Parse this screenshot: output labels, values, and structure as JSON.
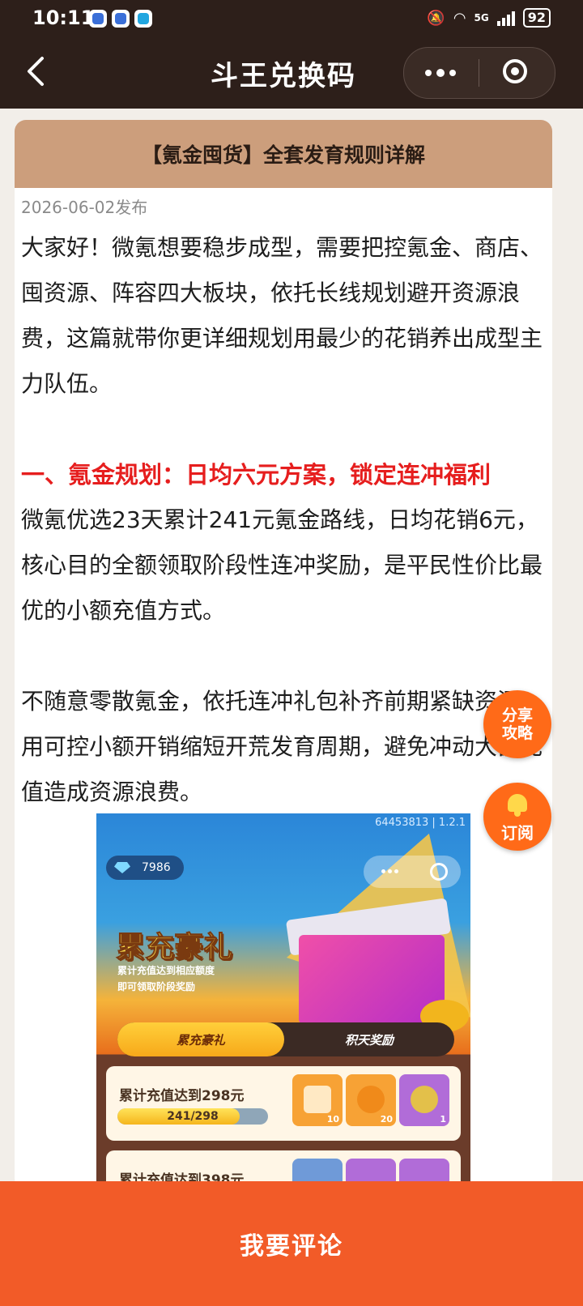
{
  "status": {
    "time": "10:11",
    "network": "5G",
    "battery": "92"
  },
  "header": {
    "title": "斗王兑换码"
  },
  "article": {
    "heading": "【氪金囤货】全套发育规则详解",
    "date": "2026-06-02发布",
    "intro": "大家好！微氪想要稳步成型，需要把控氪金、商店、囤资源、阵容四大板块，依托长线规划避开资源浪费，这篇就带你更详细规划用最少的花销养出成型主力队伍。",
    "section1_title": "一、氪金规划：日均六元方案，锁定连冲福利",
    "section1_p1": "微氪优选23天累计241元氪金路线，日均花销6元，核心目的全额领取阶段性连冲奖励，是平民性价比最优的小额充值方式。",
    "section1_p2": "不随意零散氪金，依托连冲礼包补齐前期紧缺资源，用可控小额开销缩短开荒发育周期，避免冲动大额充值造成资源浪费。"
  },
  "screenshot": {
    "version": "64453813 | 1.2.1",
    "gems": "7986",
    "promo_title": "累充豪礼",
    "promo_sub1": "累计充值达到相应额度",
    "promo_sub2": "即可领取阶段奖励",
    "tab_active": "累充豪礼",
    "tab_inactive": "积天奖励",
    "reward1_label": "累计充值达到298元",
    "reward1_progress_text": "241/298",
    "reward1_progress": 0.81,
    "reward1_counts": [
      "10",
      "20",
      "1"
    ],
    "reward2_label": "累计充值达到398元"
  },
  "float": {
    "share_line1": "分享",
    "share_line2": "攻略",
    "subscribe": "订阅"
  },
  "bottom": {
    "comment": "我要评论"
  }
}
